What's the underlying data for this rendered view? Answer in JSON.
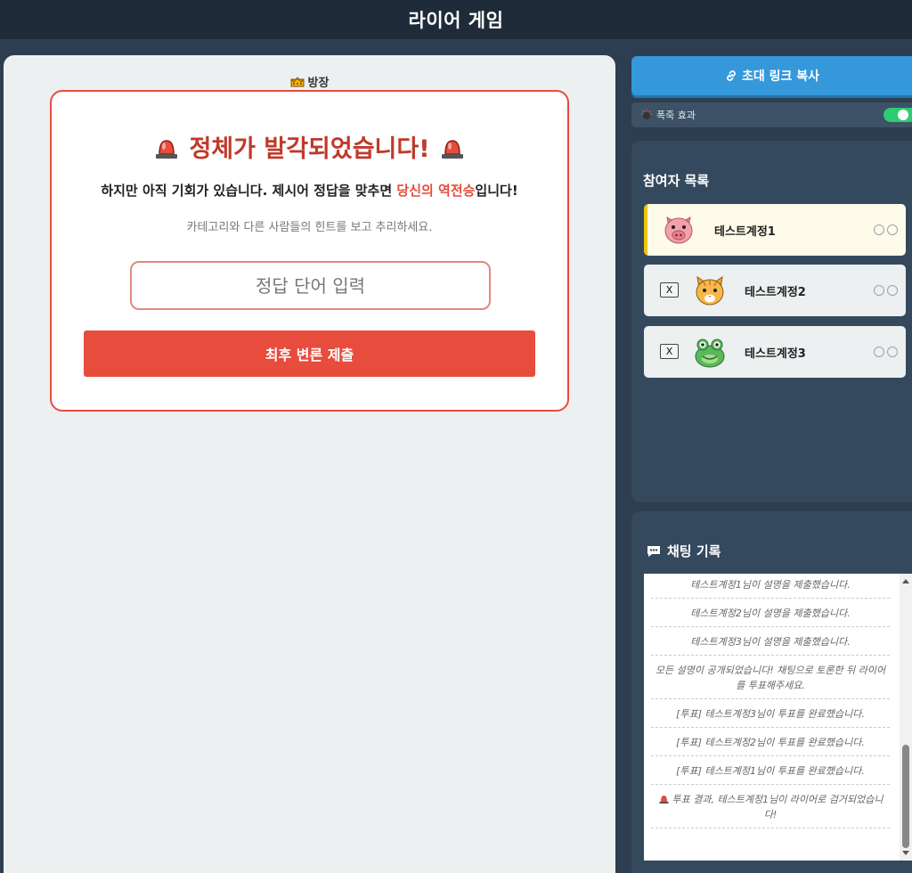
{
  "header": {
    "title": "라이어 게임"
  },
  "main": {
    "host_label": "방장",
    "card": {
      "title": "정체가 발각되었습니다!",
      "subtitle_prefix": "하지만 아직 기회가 있습니다. 제시어 정답을 맞추면 ",
      "subtitle_highlight": "당신의 역전승",
      "subtitle_suffix": "입니다!",
      "hint": "카테고리와 다른 사람들의 힌트를 보고 추리하세요.",
      "input_placeholder": "정답 단어 입력",
      "input_value": "",
      "submit_label": "최후 변론 제출"
    }
  },
  "sidebar": {
    "invite_label": "초대 링크 복사",
    "effect_label": "폭죽 효과",
    "effect_enabled": true,
    "players_title": "참여자 목록",
    "players": [
      {
        "name": "테스트계정1",
        "avatar": "pig-icon",
        "active": true,
        "kick_label": ""
      },
      {
        "name": "테스트계정2",
        "avatar": "cat-icon",
        "active": false,
        "kick_label": "X"
      },
      {
        "name": "테스트계정3",
        "avatar": "frog-icon",
        "active": false,
        "kick_label": "X"
      }
    ],
    "chat_title": "채팅 기록",
    "chat_messages": [
      "테스트계정1님이 설명을 제출했습니다.",
      "테스트계정2님이 설명을 제출했습니다.",
      "테스트계정3님이 설명을 제출했습니다.",
      "모든 설명이 공개되었습니다! 채팅으로 토론한 뒤 라이어를 투표해주세요.",
      "[투표] 테스트계정3님이 투표를 완료했습니다.",
      "[투표] 테스트계정2님이 투표를 완료했습니다.",
      "[투표] 테스트계정1님이 투표를 완료했습니다.",
      "투표 결과, 테스트계정1님이 라이어로 검거되었습니다!"
    ]
  },
  "colors": {
    "accent_red": "#e74c3c",
    "accent_blue": "#3498db",
    "toggle_green": "#2ecc71",
    "active_player": "#f1c40f"
  }
}
